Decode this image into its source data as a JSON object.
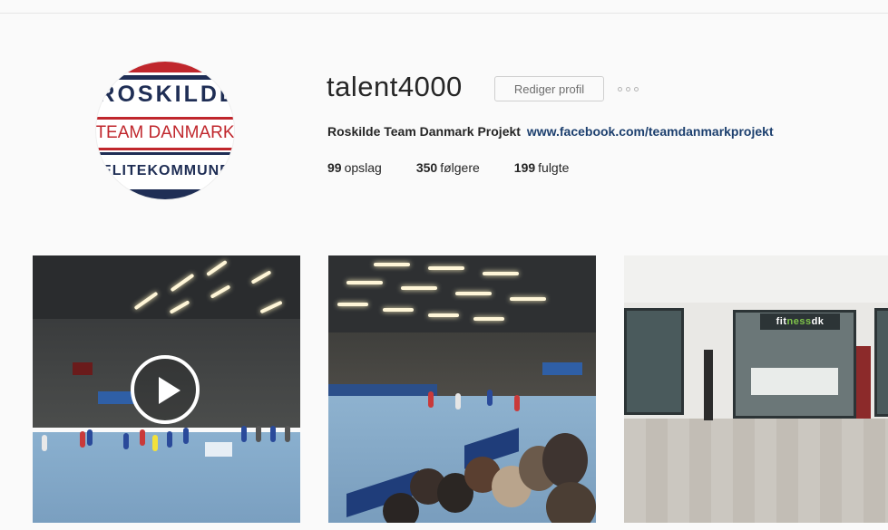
{
  "profile": {
    "username": "talent4000",
    "edit_button": "Rediger profil",
    "more_icon": "ellipsis-icon",
    "bio_name": "Roskilde Team Danmark Projekt",
    "bio_link": "www.facebook.com/teamdanmarkprojekt",
    "avatar": {
      "line1": "ROSKILDE",
      "line2": "TEAM DANMARK",
      "line3": "ELITEKOMMUNE"
    }
  },
  "stats": [
    {
      "number": "99",
      "label": "opslag"
    },
    {
      "number": "350",
      "label": "følgere"
    },
    {
      "number": "199",
      "label": "fulgte"
    }
  ],
  "posts": [
    {
      "type": "video",
      "icon": "play-icon"
    },
    {
      "type": "photo"
    },
    {
      "type": "photo",
      "sign_prefix": "fit",
      "sign_green": "ness",
      "sign_suffix": "dk"
    }
  ],
  "colors": {
    "background": "#fafafa",
    "link": "#1c3f6e",
    "danish_red": "#c0272d",
    "navy": "#1f2e55"
  }
}
